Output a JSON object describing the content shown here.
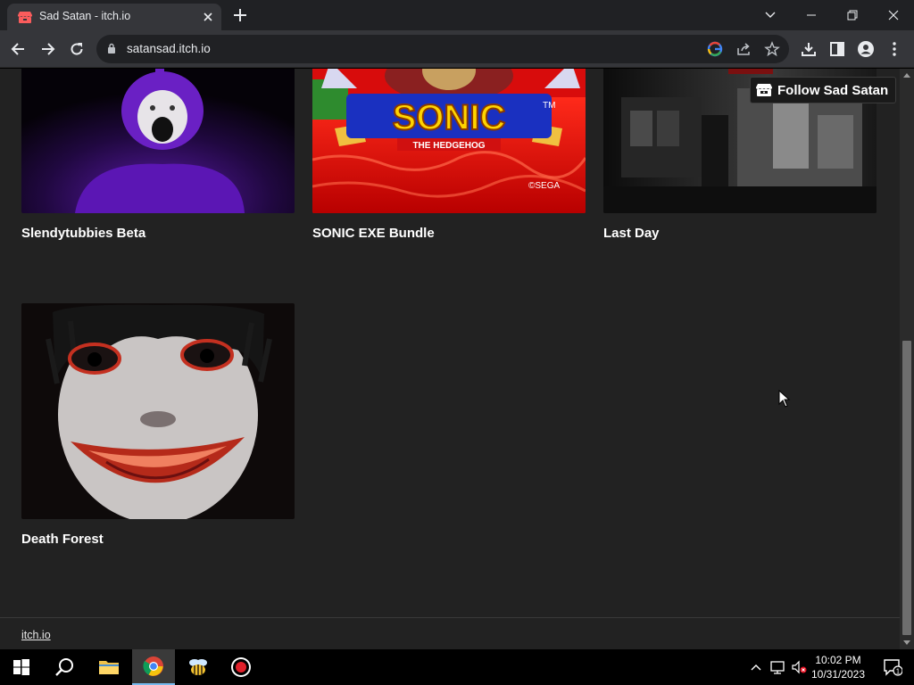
{
  "browser": {
    "tab_title": "Sad Satan - itch.io",
    "url": "satansad.itch.io"
  },
  "page": {
    "follow_label": "Follow Sad Satan",
    "games": [
      {
        "title": "Slendytubbies Beta"
      },
      {
        "title": "SONIC EXE Bundle"
      },
      {
        "title": "Last Day"
      },
      {
        "title": "Death Forest"
      }
    ],
    "thumbnail_text": {
      "sonic_logo": "SONIC",
      "sonic_subtitle": "THE HEDGEHOG",
      "sonic_tm": "TM",
      "sega": "©SEGA"
    },
    "footer_link": "itch.io"
  },
  "taskbar": {
    "time": "10:02 PM",
    "date": "10/31/2023",
    "notification_count": "1"
  },
  "colors": {
    "page_bg": "#222222",
    "chrome_dark": "#202124",
    "chrome_toolbar": "#35363a",
    "itch_red": "#fa5c5c"
  }
}
